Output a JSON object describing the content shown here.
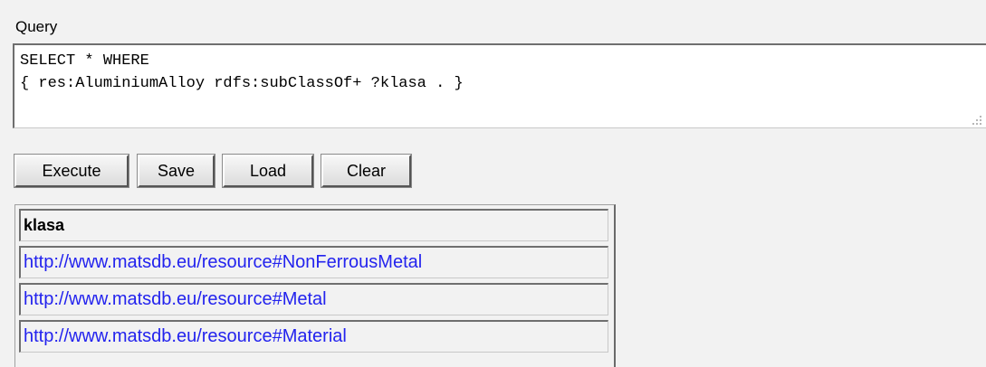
{
  "query_section": {
    "label": "Query",
    "text": "SELECT * WHERE\n{ res:AluminiumAlloy rdfs:subClassOf+ ?klasa . }"
  },
  "buttons": {
    "execute": "Execute",
    "save": "Save",
    "load": "Load",
    "clear": "Clear"
  },
  "results": {
    "columns": [
      "klasa"
    ],
    "rows": [
      "http://www.matsdb.eu/resource#NonFerrousMetal",
      "http://www.matsdb.eu/resource#Metal",
      "http://www.matsdb.eu/resource#Material"
    ],
    "link_color": "#2323ee"
  }
}
